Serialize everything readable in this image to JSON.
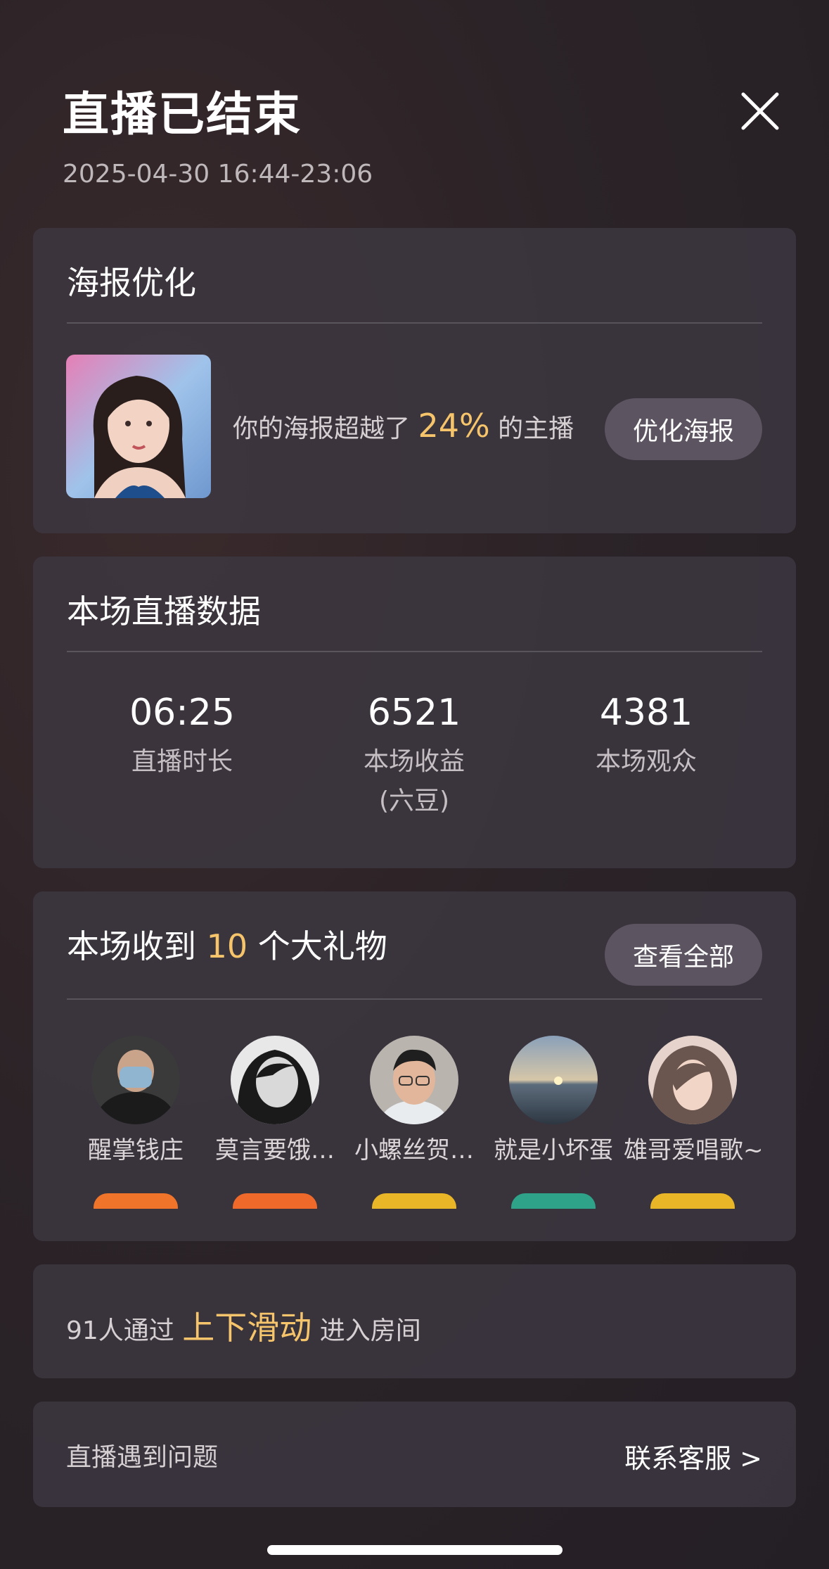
{
  "header": {
    "title": "直播已结束",
    "time": "2025-04-30 16:44-23:06"
  },
  "poster": {
    "title": "海报优化",
    "text_prefix": "你的海报超越了",
    "percent": "24%",
    "text_suffix": "的主播",
    "button": "优化海报"
  },
  "stats": {
    "title": "本场直播数据",
    "items": [
      {
        "value": "06:25",
        "label": "直播时长",
        "sub": ""
      },
      {
        "value": "6521",
        "label": "本场收益",
        "sub": "(六豆)"
      },
      {
        "value": "4381",
        "label": "本场观众",
        "sub": ""
      }
    ]
  },
  "gifts": {
    "title_prefix": "本场收到",
    "count": "10",
    "title_suffix": "个大礼物",
    "button": "查看全部",
    "users": [
      {
        "name": "醒掌钱庄"
      },
      {
        "name": "莫言要饿…"
      },
      {
        "name": "小螺丝贺…"
      },
      {
        "name": "就是小坏蛋"
      },
      {
        "name": "雄哥爱唱歌~"
      }
    ]
  },
  "swipe": {
    "prefix": "91人通过",
    "highlight": "上下滑动",
    "suffix": "进入房间"
  },
  "support": {
    "label": "直播遇到问题",
    "link": "联系客服 >"
  },
  "colors": {
    "accent": "#f5c46b",
    "card": "#3e3842",
    "pill": "#5c5460"
  }
}
